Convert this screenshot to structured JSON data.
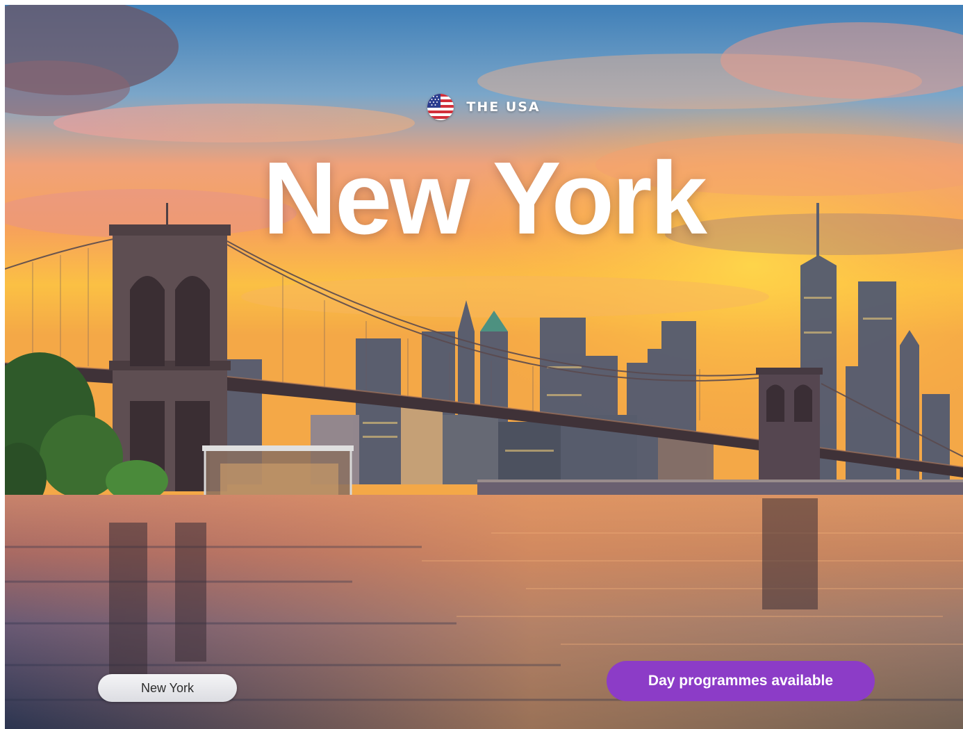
{
  "hero": {
    "country_label": "THE USA",
    "city_title": "New York",
    "country_flag_icon": "us-flag-icon",
    "scene_description_icon": "brooklyn-bridge-skyline-photo"
  },
  "location_tag": {
    "label": "New York"
  },
  "cta": {
    "label": "Day programmes available",
    "color": "#8c3cc7"
  }
}
